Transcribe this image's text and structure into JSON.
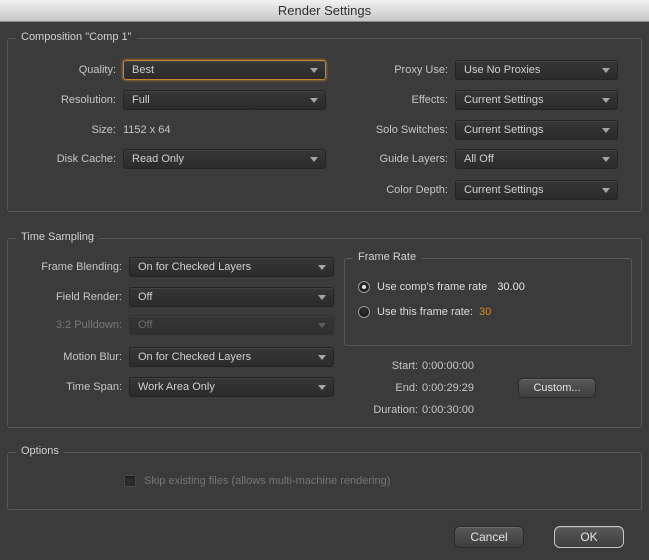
{
  "window": {
    "title": "Render Settings"
  },
  "colors": {
    "accent_orange": "#d78d2e",
    "focus_border": "#c8872e",
    "dialog_bg": "#3b3b3b"
  },
  "composition": {
    "legend": "Composition \"Comp 1\"",
    "left": [
      {
        "label": "Quality:",
        "value": "Best"
      },
      {
        "label": "Resolution:",
        "value": "Full"
      },
      {
        "label": "Size:",
        "value": "1152 x 64"
      },
      {
        "label": "Disk Cache:",
        "value": "Read Only"
      }
    ],
    "right": [
      {
        "label": "Proxy Use:",
        "value": "Use No Proxies"
      },
      {
        "label": "Effects:",
        "value": "Current Settings"
      },
      {
        "label": "Solo Switches:",
        "value": "Current Settings"
      },
      {
        "label": "Guide Layers:",
        "value": "All Off"
      },
      {
        "label": "Color Depth:",
        "value": "Current Settings"
      }
    ]
  },
  "time_sampling": {
    "legend": "Time Sampling",
    "left": [
      {
        "label": "Frame Blending:",
        "value": "On for Checked Layers"
      },
      {
        "label": "Field Render:",
        "value": "Off"
      },
      {
        "label": "3:2 Pulldown:",
        "value": "Off"
      },
      {
        "label": "Motion Blur:",
        "value": "On for Checked Layers"
      },
      {
        "label": "Time Span:",
        "value": "Work Area Only"
      }
    ],
    "frame_rate": {
      "legend": "Frame Rate",
      "comp_label": "Use comp's frame rate",
      "comp_value": "30.00",
      "custom_label": "Use this frame rate:",
      "custom_value": "30"
    },
    "times": {
      "start_label": "Start:",
      "start_value": "0:00:00:00",
      "end_label": "End:",
      "end_value": "0:00:29:29",
      "duration_label": "Duration:",
      "duration_value": "0:00:30:00",
      "custom_button": "Custom..."
    }
  },
  "options": {
    "legend": "Options",
    "skip_label": "Skip existing files (allows multi-machine rendering)"
  },
  "buttons": {
    "cancel": "Cancel",
    "ok": "OK"
  }
}
